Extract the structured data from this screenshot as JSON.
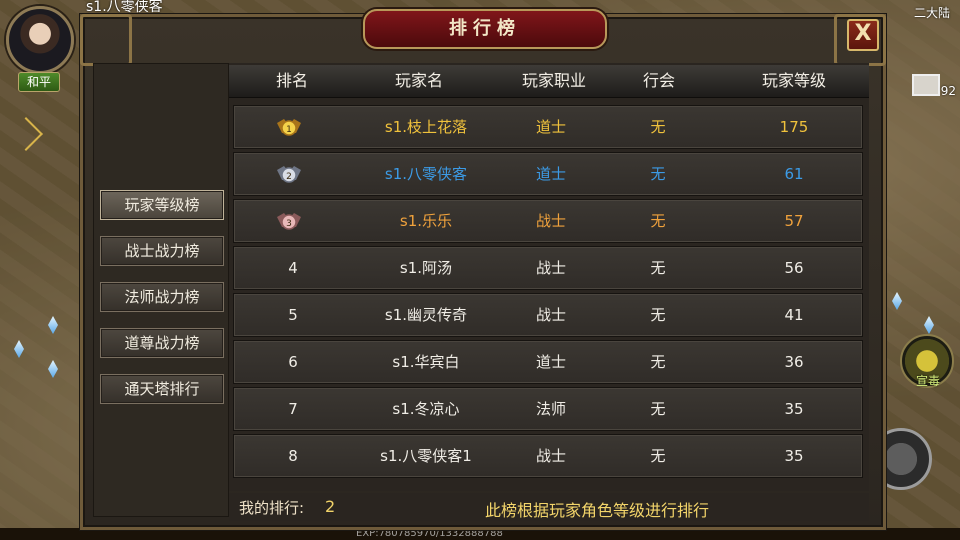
{
  "hud": {
    "top_name": "s1.八零侠客",
    "peace_mode": "和平",
    "continent": "二大陆",
    "mail_label": "邮件",
    "mail_count": "92",
    "skill_label": "宣毒",
    "exp_text": "EXP:780785970/1332888788"
  },
  "panel": {
    "title": "排行榜",
    "close_label": "X"
  },
  "sidebar": {
    "items": [
      {
        "label": "玩家等级榜",
        "active": true
      },
      {
        "label": "战士战力榜",
        "active": false
      },
      {
        "label": "法师战力榜",
        "active": false
      },
      {
        "label": "道尊战力榜",
        "active": false
      },
      {
        "label": "通天塔排行",
        "active": false
      }
    ]
  },
  "table": {
    "headers": [
      "排名",
      "玩家名",
      "玩家职业",
      "行会",
      "玩家等级"
    ],
    "rows": [
      {
        "rank": "1",
        "name": "s1.枝上花落",
        "class": "道士",
        "guild": "无",
        "level": "175",
        "color": "#f0c23c",
        "medal": "gold"
      },
      {
        "rank": "2",
        "name": "s1.八零侠客",
        "class": "道士",
        "guild": "无",
        "level": "61",
        "color": "#3c9be6",
        "medal": "silver"
      },
      {
        "rank": "3",
        "name": "s1.乐乐",
        "class": "战士",
        "guild": "无",
        "level": "57",
        "color": "#f0a23c",
        "medal": "bronze"
      },
      {
        "rank": "4",
        "name": "s1.阿汤",
        "class": "战士",
        "guild": "无",
        "level": "56",
        "color": "#f0ede6"
      },
      {
        "rank": "5",
        "name": "s1.幽灵传奇",
        "class": "战士",
        "guild": "无",
        "level": "41",
        "color": "#f0ede6"
      },
      {
        "rank": "6",
        "name": "s1.华宾白",
        "class": "道士",
        "guild": "无",
        "level": "36",
        "color": "#f0ede6"
      },
      {
        "rank": "7",
        "name": "s1.冬凉心",
        "class": "法师",
        "guild": "无",
        "level": "35",
        "color": "#f0ede6"
      },
      {
        "rank": "8",
        "name": "s1.八零侠客1",
        "class": "战士",
        "guild": "无",
        "level": "35",
        "color": "#f0ede6"
      }
    ]
  },
  "footer": {
    "my_rank_label": "我的排行:",
    "my_rank_value": "2",
    "note": "此榜根据玩家角色等级进行排行"
  }
}
